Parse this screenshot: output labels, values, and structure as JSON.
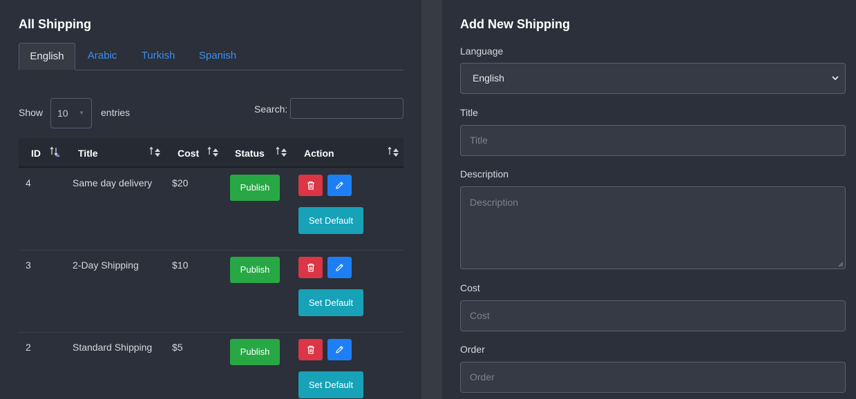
{
  "list_panel": {
    "title": "All Shipping",
    "tabs": [
      {
        "label": "English",
        "active": true
      },
      {
        "label": "Arabic",
        "active": false
      },
      {
        "label": "Turkish",
        "active": false
      },
      {
        "label": "Spanish",
        "active": false
      }
    ],
    "show_label": "Show",
    "entries_value": "10",
    "entries_label": "entries",
    "search_label": "Search:",
    "search_value": "",
    "columns": [
      "ID",
      "Title",
      "Cost",
      "Status",
      "Action"
    ],
    "rows": [
      {
        "id": "4",
        "title": "Same day delivery",
        "cost": "$20",
        "status": "Publish",
        "default_label": "Set Default"
      },
      {
        "id": "3",
        "title": "2-Day Shipping",
        "cost": "$10",
        "status": "Publish",
        "default_label": "Set Default"
      },
      {
        "id": "2",
        "title": "Standard Shipping",
        "cost": "$5",
        "status": "Publish",
        "default_label": "Set Default"
      }
    ],
    "icons": {
      "delete": "trash-icon",
      "edit": "pencil-icon",
      "sort": "sort-arrows-icon"
    }
  },
  "form_panel": {
    "title": "Add New Shipping",
    "language_label": "Language",
    "language_value": "English",
    "title_label": "Title",
    "title_placeholder": "Title",
    "description_label": "Description",
    "description_placeholder": "Description",
    "cost_label": "Cost",
    "cost_placeholder": "Cost",
    "order_label": "Order",
    "order_placeholder": "Order"
  },
  "colors": {
    "publish": "#28a745",
    "delete": "#dc3545",
    "edit": "#1e7ff5",
    "set_default": "#17a2b8",
    "tab_link": "#3b8ef0"
  }
}
